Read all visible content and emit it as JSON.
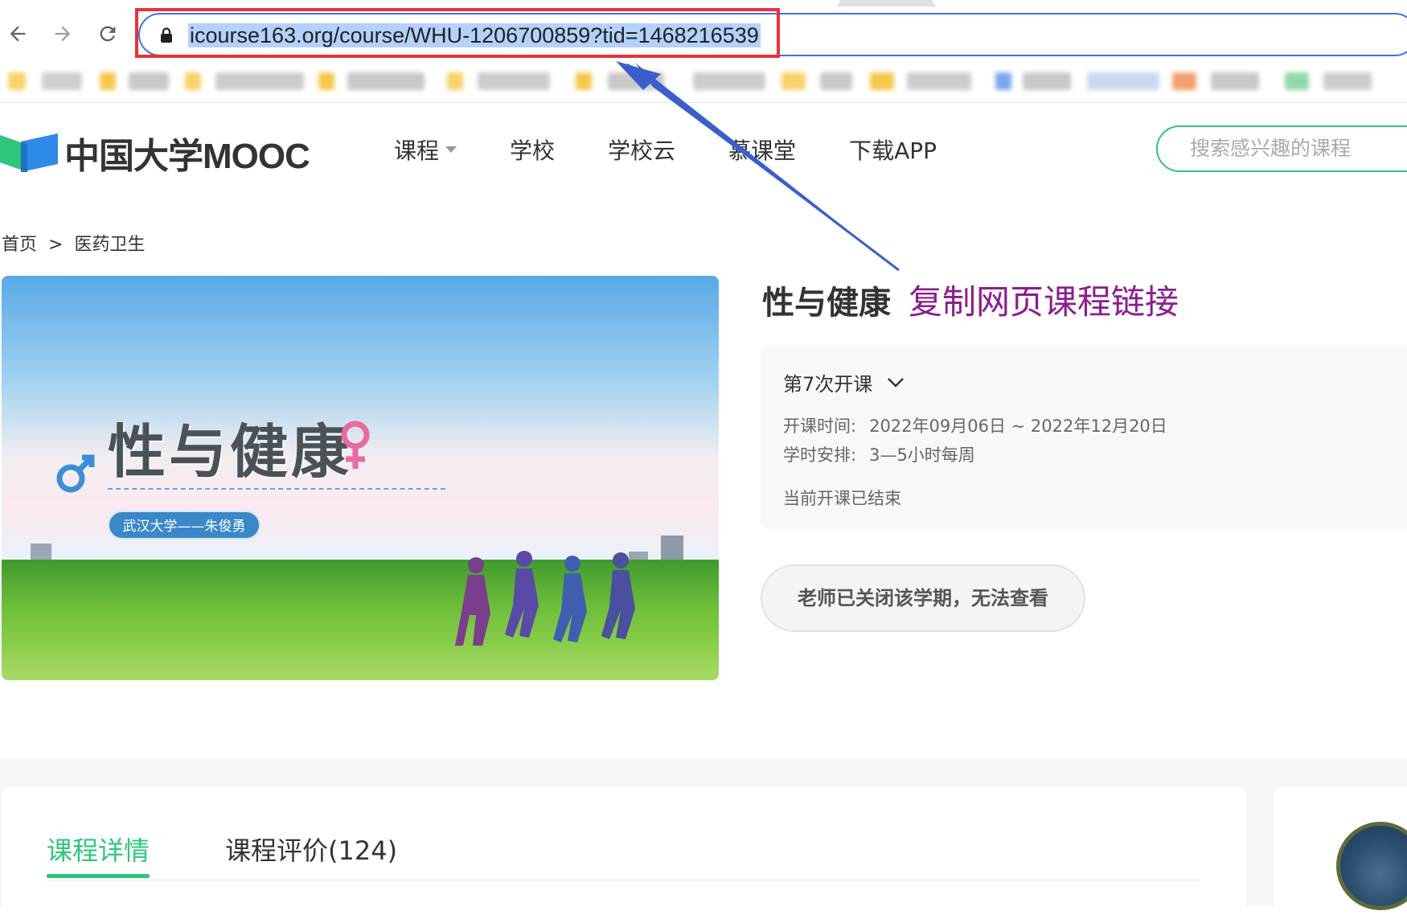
{
  "browser": {
    "url": "icourse163.org/course/WHU-1206700859?tid=1468216539",
    "back_icon": "arrow-left-icon",
    "forward_icon": "arrow-right-icon",
    "reload_icon": "reload-icon",
    "lock_icon": "lock-icon"
  },
  "site": {
    "logo_text": "中国大学MOOC",
    "nav": [
      "课程",
      "学校",
      "学校云",
      "慕课堂",
      "下载APP"
    ],
    "search_placeholder": "搜索感兴趣的课程"
  },
  "breadcrumb": {
    "home": "首页",
    "separator": ">",
    "category": "医药卫生"
  },
  "banner": {
    "title": "性与健康",
    "tag": "武汉大学——朱俊勇"
  },
  "course": {
    "title": "性与健康",
    "annotation": "复制网页课程链接",
    "term": "第7次开课",
    "time_label": "开课时间:",
    "time_value": "2022年09月06日 ~ 2022年12月20日",
    "hours_label": "学时安排:",
    "hours_value": "3—5小时每周",
    "status": "当前开课已结束",
    "closed_button": "老师已关闭该学期，无法查看"
  },
  "tabs": [
    {
      "label": "课程详情",
      "active": true
    },
    {
      "label": "课程评价(124)",
      "active": false
    }
  ],
  "colors": {
    "brand_green": "#2dc67b",
    "annotation_purple": "#8b1d8f",
    "highlight_red": "#e8313a",
    "arrow_blue": "#3a5fcd"
  }
}
